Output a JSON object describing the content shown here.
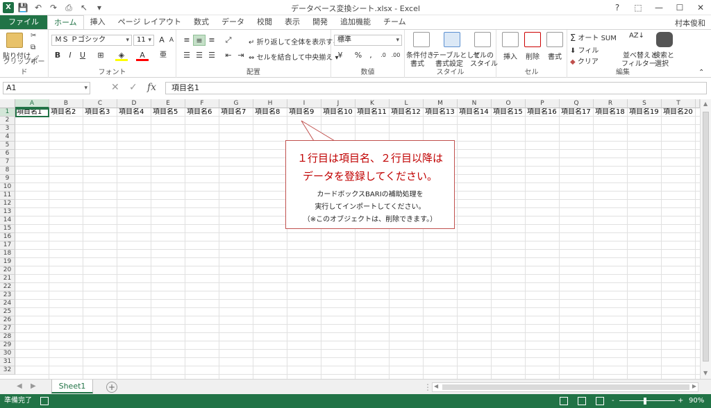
{
  "window": {
    "title": "データベース変換シート.xlsx - Excel",
    "user": "村本俊和",
    "help": "?",
    "minimize": "—",
    "maximize": "☐",
    "close": "✕"
  },
  "tabs": [
    "ファイル",
    "ホーム",
    "挿入",
    "ページ レイアウト",
    "数式",
    "データ",
    "校閲",
    "表示",
    "開発",
    "追加機能",
    "チーム"
  ],
  "active_tab": "ホーム",
  "ribbon": {
    "clipboard": {
      "paste_label": "貼り付け",
      "group_label": "クリップボード"
    },
    "font": {
      "font_name": "ＭＳ Ｐゴシック",
      "font_size": "11",
      "bold": "B",
      "italic": "I",
      "underline": "U",
      "grow": "A",
      "shrink": "A",
      "font_color": "A",
      "phonetic": "亜",
      "group_label": "フォント"
    },
    "alignment": {
      "wrap_text": "折り返して全体を表示する",
      "merge_center": "セルを結合して中央揃え",
      "group_label": "配置"
    },
    "number": {
      "format": "標準",
      "percent": "%",
      "comma": ",",
      "group_label": "数値"
    },
    "styles": {
      "conditional": "条件付き",
      "conditional2": "書式",
      "table": "テーブルとして",
      "table2": "書式設定",
      "cell_style": "セルの",
      "cell_style2": "スタイル",
      "group_label": "スタイル"
    },
    "cells": {
      "insert": "挿入",
      "delete": "削除",
      "format": "書式",
      "group_label": "セル"
    },
    "editing": {
      "autosum": "オート SUM",
      "fill": "フィル",
      "clear": "クリア",
      "sort": "並べ替えと",
      "sort2": "フィルター",
      "find": "検索と",
      "find2": "選択",
      "group_label": "編集"
    }
  },
  "formula_bar": {
    "name_box": "A1",
    "fx": "fx",
    "value": "項目名1"
  },
  "grid": {
    "columns": [
      "A",
      "B",
      "C",
      "D",
      "E",
      "F",
      "G",
      "H",
      "I",
      "J",
      "K",
      "L",
      "M",
      "N",
      "O",
      "P",
      "Q",
      "R",
      "S",
      "T"
    ],
    "rows": [
      "1",
      "2",
      "3",
      "4",
      "5",
      "6",
      "7",
      "8",
      "9",
      "10",
      "11",
      "12",
      "13",
      "14",
      "15",
      "16",
      "17",
      "18",
      "19",
      "20",
      "21",
      "22",
      "23",
      "24",
      "25",
      "26",
      "27",
      "28",
      "29",
      "30",
      "31",
      "32"
    ],
    "row1": [
      "項目名1",
      "項目名2",
      "項目名3",
      "項目名4",
      "項目名5",
      "項目名6",
      "項目名7",
      "項目名8",
      "項目名9",
      "項目名10",
      "項目名11",
      "項目名12",
      "項目名13",
      "項目名14",
      "項目名15",
      "項目名16",
      "項目名17",
      "項目名18",
      "項目名19",
      "項目名20"
    ]
  },
  "callout": {
    "line1": "１行目は項目名、２行目以降は",
    "line2": "データを登録してください。",
    "sub1": "カードボックスBARIの補助処理を",
    "sub2": "実行してインポートしてください。",
    "sub3": "（※このオブジェクトは、削除できます。）"
  },
  "sheets": {
    "tab": "Sheet1",
    "add": "+"
  },
  "status": {
    "text": "準備完了",
    "zoom": "90%",
    "zoom_minus": "-",
    "zoom_plus": "+"
  },
  "colors": {
    "accent": "#217346",
    "callout_border": "#c0504d",
    "callout_text": "#c00000"
  }
}
